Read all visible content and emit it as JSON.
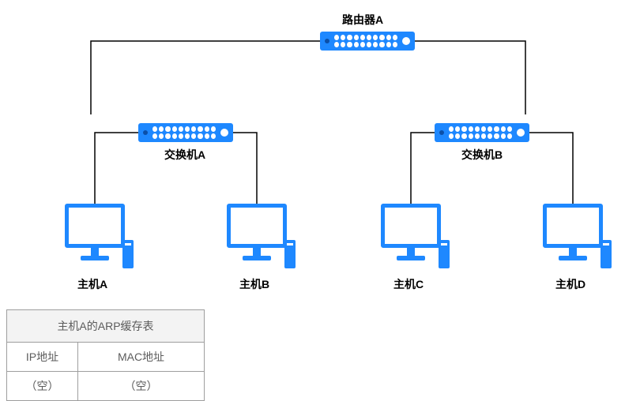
{
  "labels": {
    "router": "路由器A",
    "switchA": "交换机A",
    "switchB": "交换机B",
    "hostA": "主机A",
    "hostB": "主机B",
    "hostC": "主机C",
    "hostD": "主机D"
  },
  "arp_table": {
    "title": "主机A的ARP缓存表",
    "col_ip": "IP地址",
    "col_mac": "MAC地址",
    "empty_ip": "（空）",
    "empty_mac": "（空）"
  },
  "colors": {
    "device": "#1e88ff",
    "wire": "#000000"
  }
}
